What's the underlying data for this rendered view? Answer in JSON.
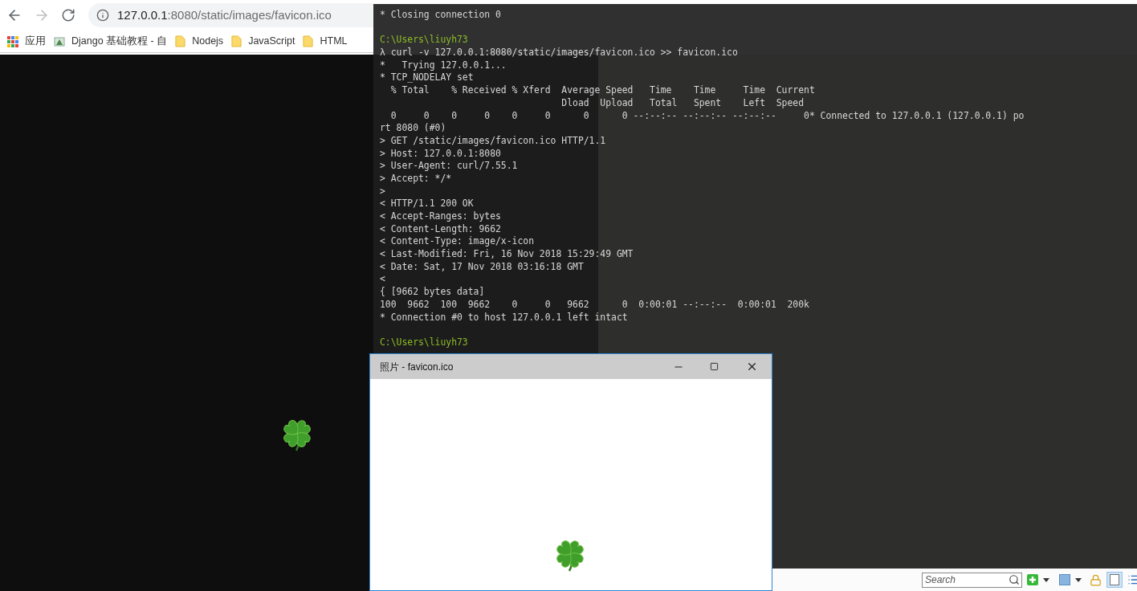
{
  "browser": {
    "address": {
      "host": "127.0.0.1",
      "path": ":8080/static/images/favicon.ico"
    },
    "bookmarks": [
      {
        "kind": "apps",
        "label": "应用"
      },
      {
        "kind": "site",
        "label": "Django 基础教程 - 自"
      },
      {
        "kind": "folder",
        "label": "Nodejs"
      },
      {
        "kind": "folder",
        "label": "JavaScript"
      },
      {
        "kind": "folder",
        "label": "HTML"
      }
    ]
  },
  "terminal": {
    "lines": [
      {
        "kind": "output",
        "text": "* Closing connection 0"
      },
      {
        "kind": "blank"
      },
      {
        "kind": "prompt",
        "text": "C:\\Users\\liuyh73"
      },
      {
        "kind": "output",
        "text": "λ curl -v 127.0.0.1:8080/static/images/favicon.ico >> favicon.ico"
      },
      {
        "kind": "output",
        "text": "*   Trying 127.0.0.1..."
      },
      {
        "kind": "output",
        "text": "* TCP_NODELAY set"
      },
      {
        "kind": "output",
        "text": "  % Total    % Received % Xferd  Average Speed   Time    Time     Time  Current"
      },
      {
        "kind": "output",
        "text": "                                 Dload  Upload   Total   Spent    Left  Speed"
      },
      {
        "kind": "output",
        "text": "  0     0    0     0    0     0      0      0 --:--:-- --:--:-- --:--:--     0* Connected to 127.0.0.1 (127.0.0.1) po"
      },
      {
        "kind": "output",
        "text": "rt 8080 (#0)"
      },
      {
        "kind": "output",
        "text": "> GET /static/images/favicon.ico HTTP/1.1"
      },
      {
        "kind": "output",
        "text": "> Host: 127.0.0.1:8080"
      },
      {
        "kind": "output",
        "text": "> User-Agent: curl/7.55.1"
      },
      {
        "kind": "output",
        "text": "> Accept: */*"
      },
      {
        "kind": "output",
        "text": ">"
      },
      {
        "kind": "output",
        "text": "< HTTP/1.1 200 OK"
      },
      {
        "kind": "output",
        "text": "< Accept-Ranges: bytes"
      },
      {
        "kind": "output",
        "text": "< Content-Length: 9662"
      },
      {
        "kind": "output",
        "text": "< Content-Type: image/x-icon"
      },
      {
        "kind": "output",
        "text": "< Last-Modified: Fri, 16 Nov 2018 15:29:49 GMT"
      },
      {
        "kind": "output",
        "text": "< Date: Sat, 17 Nov 2018 03:16:18 GMT"
      },
      {
        "kind": "output",
        "text": "<"
      },
      {
        "kind": "output",
        "text": "{ [9662 bytes data]"
      },
      {
        "kind": "output",
        "text": "100  9662  100  9662    0     0   9662      0  0:00:01 --:--:--  0:00:01  200k"
      },
      {
        "kind": "output",
        "text": "* Connection #0 to host 127.0.0.1 left intact"
      },
      {
        "kind": "blank"
      },
      {
        "kind": "prompt",
        "text": "C:\\Users\\liuyh73"
      }
    ]
  },
  "photo_viewer": {
    "title": "照片 - favicon.ico"
  },
  "bottom_toolbar": {
    "search": {
      "placeholder": "Search"
    }
  }
}
